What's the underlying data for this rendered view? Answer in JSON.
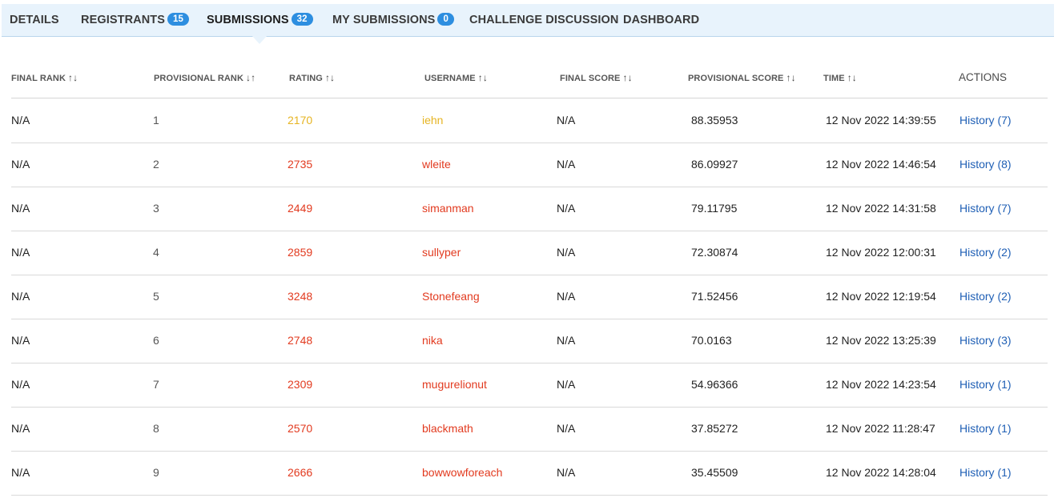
{
  "tabs": [
    {
      "label": "DETAILS"
    },
    {
      "label": "REGISTRANTS",
      "badge": "15"
    },
    {
      "label": "SUBMISSIONS",
      "badge": "32",
      "active": true
    },
    {
      "label": "MY SUBMISSIONS",
      "badge": "0"
    },
    {
      "label": "CHALLENGE DISCUSSION"
    },
    {
      "label": "DASHBOARD"
    }
  ],
  "columns": {
    "final_rank": "FINAL RANK",
    "provisional_rank": "PROVISIONAL RANK",
    "rating": "RATING",
    "username": "USERNAME",
    "final_score": "FINAL SCORE",
    "provisional_score": "PROVISIONAL SCORE",
    "time": "TIME",
    "actions": "ACTIONS"
  },
  "sort_icons": {
    "default": "↑↓",
    "active_desc": "↓↑"
  },
  "colors": {
    "yellow": "#e6b422",
    "red": "#e23a1f",
    "link": "#1f5fb5",
    "badge": "#2d8ee0"
  },
  "rows": [
    {
      "final_rank": "N/A",
      "provisional_rank": "1",
      "rating": "2170",
      "rating_color": "#e6b422",
      "username": "iehn",
      "final_score": "N/A",
      "provisional_score": "88.35953",
      "time": "12 Nov 2022 14:39:55",
      "action": "History (7)"
    },
    {
      "final_rank": "N/A",
      "provisional_rank": "2",
      "rating": "2735",
      "rating_color": "#e23a1f",
      "username": "wleite",
      "final_score": "N/A",
      "provisional_score": "86.09927",
      "time": "12 Nov 2022 14:46:54",
      "action": "History (8)"
    },
    {
      "final_rank": "N/A",
      "provisional_rank": "3",
      "rating": "2449",
      "rating_color": "#e23a1f",
      "username": "simanman",
      "final_score": "N/A",
      "provisional_score": "79.11795",
      "time": "12 Nov 2022 14:31:58",
      "action": "History (7)"
    },
    {
      "final_rank": "N/A",
      "provisional_rank": "4",
      "rating": "2859",
      "rating_color": "#e23a1f",
      "username": "sullyper",
      "final_score": "N/A",
      "provisional_score": "72.30874",
      "time": "12 Nov 2022 12:00:31",
      "action": "History (2)"
    },
    {
      "final_rank": "N/A",
      "provisional_rank": "5",
      "rating": "3248",
      "rating_color": "#e23a1f",
      "username": "Stonefeang",
      "final_score": "N/A",
      "provisional_score": "71.52456",
      "time": "12 Nov 2022 12:19:54",
      "action": "History (2)"
    },
    {
      "final_rank": "N/A",
      "provisional_rank": "6",
      "rating": "2748",
      "rating_color": "#e23a1f",
      "username": "nika",
      "final_score": "N/A",
      "provisional_score": "70.0163",
      "time": "12 Nov 2022 13:25:39",
      "action": "History (3)"
    },
    {
      "final_rank": "N/A",
      "provisional_rank": "7",
      "rating": "2309",
      "rating_color": "#e23a1f",
      "username": "mugurelionut",
      "final_score": "N/A",
      "provisional_score": "54.96366",
      "time": "12 Nov 2022 14:23:54",
      "action": "History (1)"
    },
    {
      "final_rank": "N/A",
      "provisional_rank": "8",
      "rating": "2570",
      "rating_color": "#e23a1f",
      "username": "blackmath",
      "final_score": "N/A",
      "provisional_score": "37.85272",
      "time": "12 Nov 2022 11:28:47",
      "action": "History (1)"
    },
    {
      "final_rank": "N/A",
      "provisional_rank": "9",
      "rating": "2666",
      "rating_color": "#e23a1f",
      "username": "bowwowforeach",
      "final_score": "N/A",
      "provisional_score": "35.45509",
      "time": "12 Nov 2022 14:28:04",
      "action": "History (1)"
    }
  ]
}
